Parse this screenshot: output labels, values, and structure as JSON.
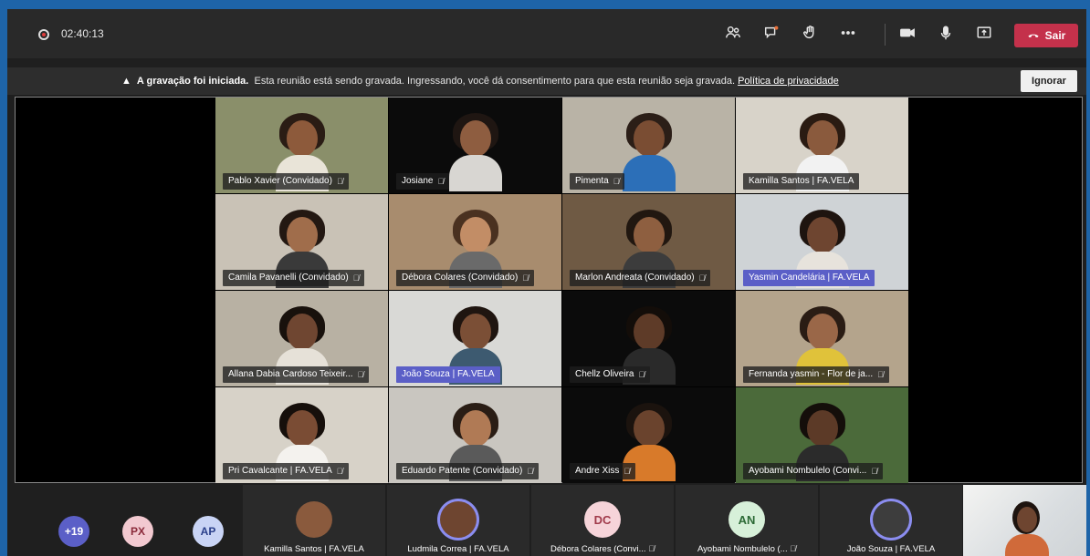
{
  "meeting": {
    "timer": "02:40:13",
    "leave_label": "Sair",
    "icons": [
      "participants-icon",
      "chat-icon",
      "raise-hand-icon",
      "more-icon",
      "camera-icon",
      "mic-icon",
      "share-icon"
    ]
  },
  "banner": {
    "title": "A gravação foi iniciada.",
    "message": "Esta reunião está sendo gravada. Ingressando, você dá consentimento para que esta reunião seja gravada.",
    "link": "Política de privacidade",
    "dismiss_label": "Ignorar"
  },
  "participants": [
    {
      "name": "Pablo Xavier (Convidado)",
      "bg": "#8a8f6a",
      "skin": "#8d5a3b",
      "hair": "#2a1c14",
      "shirt": "#e9e4d8",
      "muted": true,
      "active": false
    },
    {
      "name": "Josiane",
      "bg": "#0b0b0b",
      "skin": "#8e5d40",
      "hair": "#1f1612",
      "shirt": "#d8d6d2",
      "muted": true,
      "active": false
    },
    {
      "name": "Pimenta",
      "bg": "#b9b3a6",
      "skin": "#7a4d33",
      "hair": "#2b1e17",
      "shirt": "#2c6fb8",
      "muted": true,
      "active": false
    },
    {
      "name": "Kamilla Santos | FA.VELA",
      "bg": "#d8d3c9",
      "skin": "#8a5a3d",
      "hair": "#2a1b12",
      "shirt": "#f2f2f2",
      "muted": false,
      "active": false
    },
    {
      "name": "Camila Pavanelli (Convidado)",
      "bg": "#c9c2b6",
      "skin": "#a06d4b",
      "hair": "#231812",
      "shirt": "#3a3a3a",
      "muted": true,
      "active": false
    },
    {
      "name": "Débora Colares (Convidado)",
      "bg": "#a88c6e",
      "skin": "#c28d66",
      "hair": "#4a3120",
      "shirt": "#6a6a6a",
      "muted": true,
      "active": false
    },
    {
      "name": "Marlon Andreata (Convidado)",
      "bg": "#6f5a44",
      "skin": "#8e5f40",
      "hair": "#211710",
      "shirt": "#3c3c3c",
      "muted": true,
      "active": false
    },
    {
      "name": "Yasmin Candelária | FA.VELA",
      "bg": "#cfd3d6",
      "skin": "#6e4530",
      "hair": "#1e140f",
      "shirt": "#e7e3dc",
      "muted": false,
      "active": true
    },
    {
      "name": "Allana Dabia Cardoso Teixeir...",
      "bg": "#b8b1a3",
      "skin": "#6f4631",
      "hair": "#18110c",
      "shirt": "#e6e1d8",
      "muted": true,
      "active": false
    },
    {
      "name": "João Souza | FA.VELA",
      "bg": "#d9d9d6",
      "skin": "#7b4f36",
      "hair": "#1f1510",
      "shirt": "#3d5a70",
      "muted": false,
      "active": true
    },
    {
      "name": "Chellz Oliveira",
      "bg": "#0b0b0b",
      "skin": "#5e3b28",
      "hair": "#130d09",
      "shirt": "#2a2a2a",
      "muted": true,
      "active": false
    },
    {
      "name": "Fernanda yasmin - Flor de ja...",
      "bg": "#b4a48c",
      "skin": "#9a6748",
      "hair": "#2a1c14",
      "shirt": "#e0c23a",
      "muted": true,
      "active": false
    },
    {
      "name": "Pri Cavalcante | FA.VELA",
      "bg": "#d7d2c8",
      "skin": "#7a4c34",
      "hair": "#160f0b",
      "shirt": "#f4f2ee",
      "muted": true,
      "active": false
    },
    {
      "name": "Eduardo Patente (Convidado)",
      "bg": "#c9c6c0",
      "skin": "#b07a55",
      "hair": "#2a1d15",
      "shirt": "#5a5a5a",
      "muted": true,
      "active": false
    },
    {
      "name": "Andre Xiss",
      "bg": "#0b0b0b",
      "skin": "#6a432d",
      "hair": "#1b130e",
      "shirt": "#d87a2a",
      "muted": true,
      "active": false
    },
    {
      "name": "Ayobami Nombulelo (Convi...",
      "bg": "#4b6a3a",
      "skin": "#5c3a27",
      "hair": "#140e0a",
      "shirt": "#2b2b2b",
      "muted": true,
      "active": false
    }
  ],
  "roster": {
    "overflow_count": "+19",
    "pills": [
      {
        "initials": "PX",
        "bg": "#f2c9d0",
        "fg": "#8a2a3a"
      },
      {
        "initials": "AP",
        "bg": "#c9d4f5",
        "fg": "#2a3f8a"
      }
    ],
    "tiles": [
      {
        "name": "Kamilla Santos | FA.VELA",
        "initials": "",
        "bg": "#8a5a3d",
        "fg": "#fff",
        "ring": false,
        "muted": false
      },
      {
        "name": "Ludmila Correa | FA.VELA",
        "initials": "",
        "bg": "#6e4530",
        "fg": "#fff",
        "ring": true,
        "muted": false
      },
      {
        "name": "Débora Colares (Convi...",
        "initials": "DC",
        "bg": "#f6d4d9",
        "fg": "#a03a4a",
        "ring": false,
        "muted": true
      },
      {
        "name": "Ayobami Nombulelo (...",
        "initials": "AN",
        "bg": "#d7f0d9",
        "fg": "#2c6a35",
        "ring": false,
        "muted": true
      },
      {
        "name": "João Souza | FA.VELA",
        "initials": "",
        "bg": "#3d3d3d",
        "fg": "#fff",
        "ring": true,
        "muted": false
      }
    ]
  }
}
